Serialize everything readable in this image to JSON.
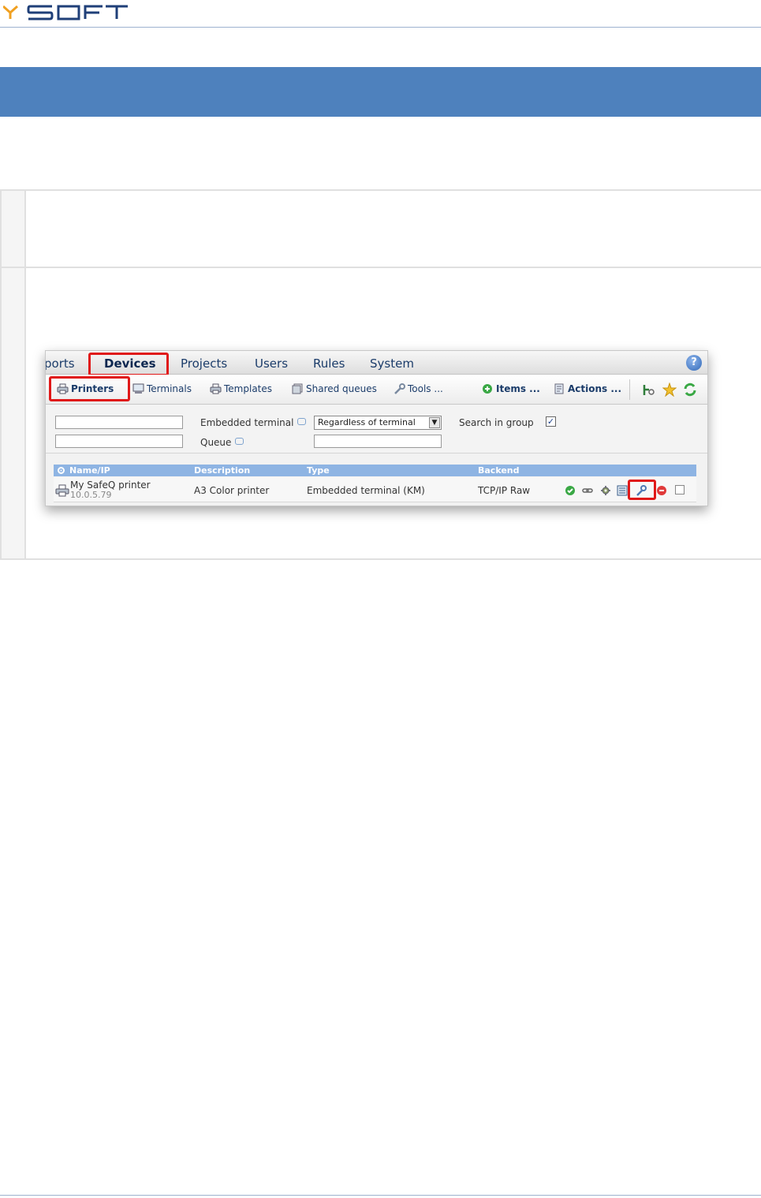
{
  "logo": {
    "text": "YSOFT"
  },
  "screenshot": {
    "top_nav": {
      "tabs": [
        "ports",
        "Devices",
        "Projects",
        "Users",
        "Rules",
        "System"
      ],
      "help": "?"
    },
    "sub_nav": {
      "printers": "Printers",
      "terminals": "Terminals",
      "templates": "Templates",
      "shared_queues": "Shared queues",
      "tools": "Tools ...",
      "items": "Items ...",
      "actions": "Actions ..."
    },
    "filters": {
      "embedded_terminal_label": "Embedded terminal",
      "embedded_terminal_value": "Regardless of terminal",
      "queue_label": "Queue",
      "search_in_group_label": "Search in group",
      "search_in_group_checked": true,
      "checkmark": "✓",
      "dropdown_arrow": "▼"
    },
    "grid": {
      "columns": [
        "Name/IP",
        "Description",
        "Type",
        "Backend"
      ],
      "rows": [
        {
          "name": "My SafeQ printer",
          "ip": "10.0.5.79",
          "description": "A3 Color printer",
          "type": "Embedded terminal (KM)",
          "backend": "TCP/IP Raw"
        }
      ],
      "row_actions": [
        "status-ok-icon",
        "link-icon",
        "settings-gear-icon",
        "queue-list-icon",
        "wrench-edit-icon",
        "delete-icon"
      ]
    }
  },
  "colors": {
    "band": "#4e81bd",
    "highlight": "#e01818",
    "grid_header": "#8eb4e3"
  }
}
